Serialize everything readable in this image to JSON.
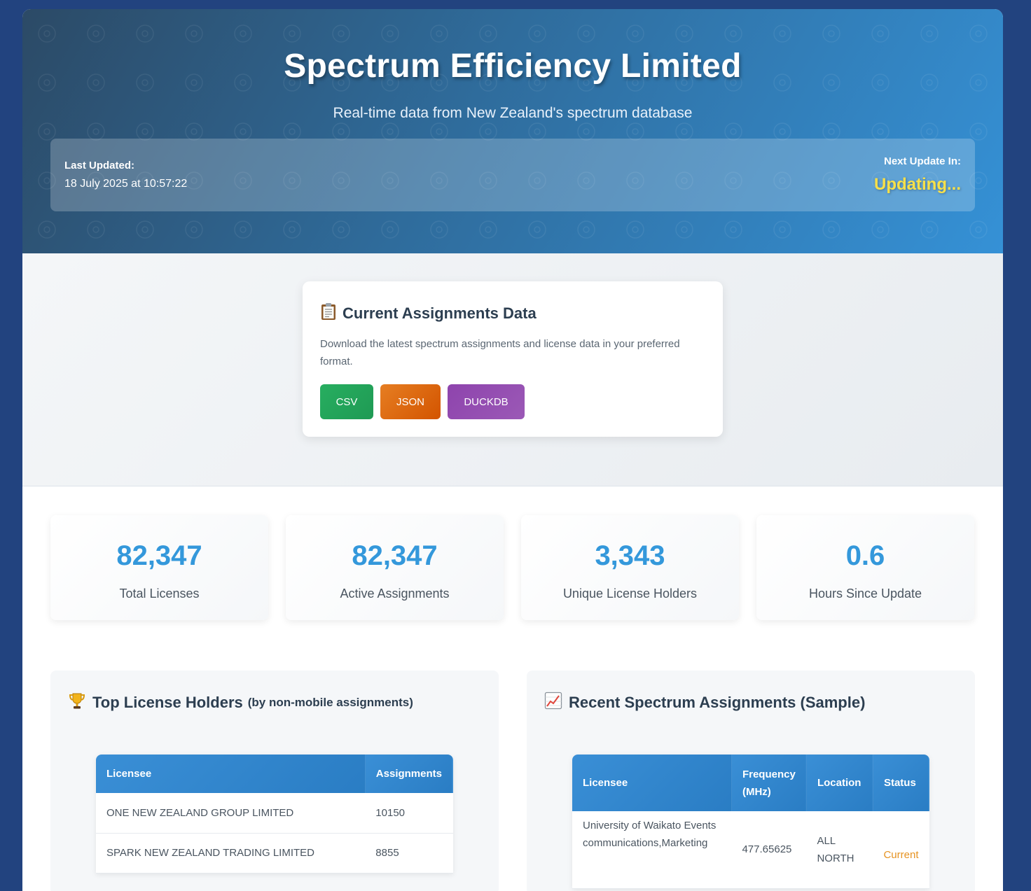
{
  "header": {
    "title": "Spectrum Efficiency Limited",
    "subtitle": "Real-time data from New Zealand's spectrum database",
    "last_updated_label": "Last Updated:",
    "last_updated_value": "18 July 2025 at 10:57:22",
    "next_update_label": "Next Update In:",
    "next_update_value": "Updating..."
  },
  "download": {
    "icon": "clipboard-icon",
    "title": "Current Assignments Data",
    "description": "Download the latest spectrum assignments and license data in your preferred format.",
    "buttons": [
      {
        "label": "CSV",
        "color": "#27ae60"
      },
      {
        "label": "JSON",
        "color": "#e67e22"
      },
      {
        "label": "DUCKDB",
        "color": "#8e44ad"
      }
    ]
  },
  "stats": [
    {
      "value": "82,347",
      "label": "Total Licenses"
    },
    {
      "value": "82,347",
      "label": "Active Assignments"
    },
    {
      "value": "3,343",
      "label": "Unique License Holders"
    },
    {
      "value": "0.6",
      "label": "Hours Since Update"
    }
  ],
  "top_holders": {
    "icon": "trophy-icon",
    "title": "Top License Holders",
    "subtitle": "(by non-mobile assignments)",
    "columns": [
      "Licensee",
      "Assignments"
    ],
    "rows": [
      [
        "ONE NEW ZEALAND GROUP LIMITED",
        "10150"
      ],
      [
        "SPARK NEW ZEALAND TRADING LIMITED",
        "8855"
      ]
    ]
  },
  "recent": {
    "icon": "chart-increasing-icon",
    "title": "Recent Spectrum Assignments (Sample)",
    "columns": [
      "Licensee",
      "Frequency (MHz)",
      "Location",
      "Status"
    ],
    "rows": [
      [
        "University of Waikato Events communications,Marketing",
        "477.65625",
        "ALL NORTH",
        "Current"
      ]
    ]
  },
  "colors": {
    "accent": "#3498db",
    "header_start": "#2c4a66",
    "header_end": "#3591d6",
    "updating": "#f7e04a",
    "status_current": "#e69322",
    "background": "#22437f"
  }
}
